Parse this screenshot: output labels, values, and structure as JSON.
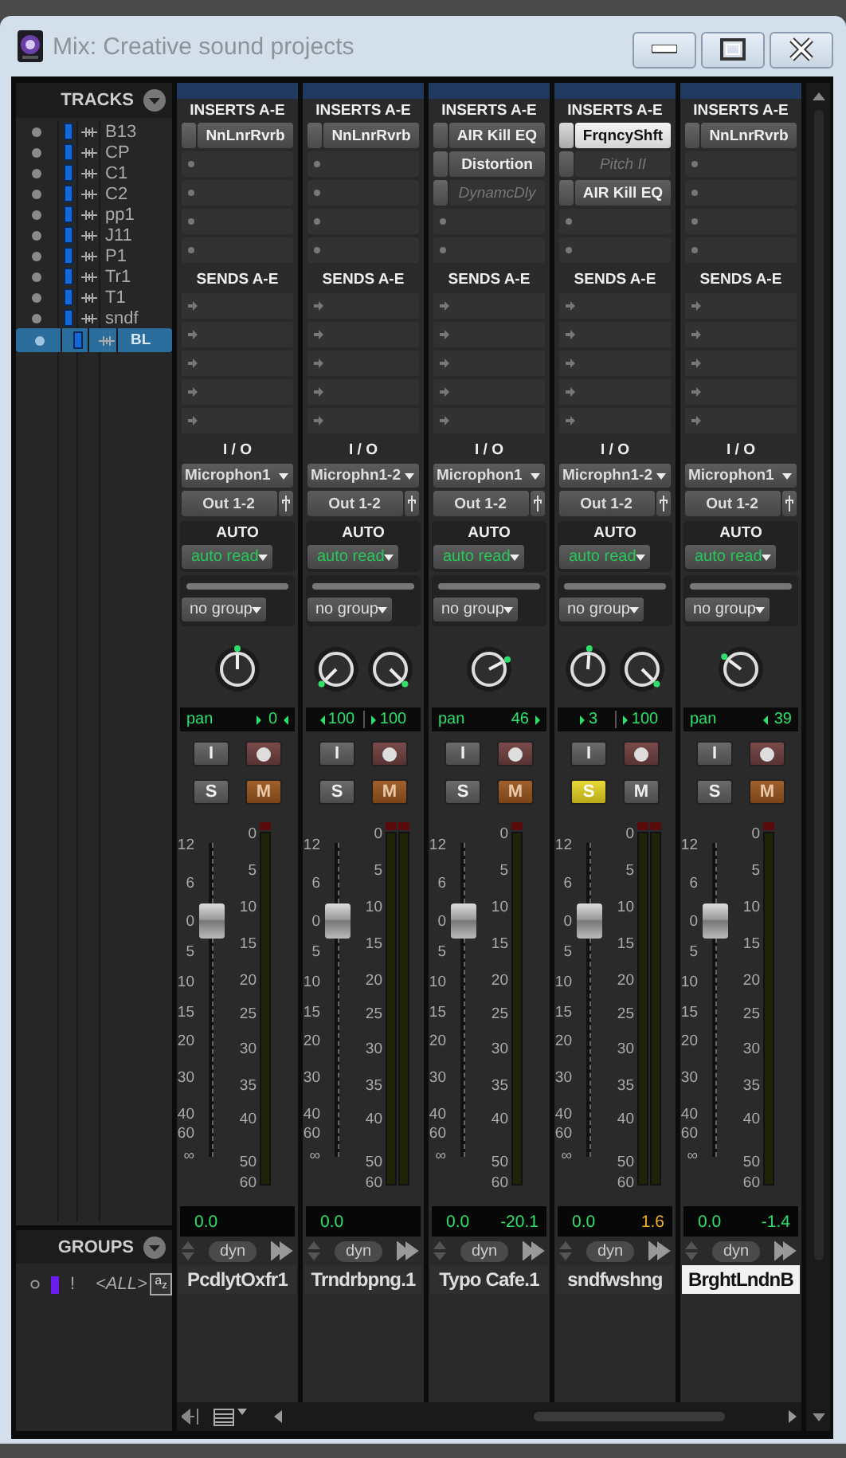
{
  "window": {
    "title": "Mix: Creative sound projects"
  },
  "tracks_panel": {
    "title": "TRACKS",
    "tracks": [
      {
        "name": "B13",
        "selected": false
      },
      {
        "name": "CP",
        "selected": false
      },
      {
        "name": "C1",
        "selected": false
      },
      {
        "name": "C2",
        "selected": false
      },
      {
        "name": "pp1",
        "selected": false
      },
      {
        "name": "J11",
        "selected": false
      },
      {
        "name": "P1",
        "selected": false
      },
      {
        "name": "Tr1",
        "selected": false
      },
      {
        "name": "T1",
        "selected": false
      },
      {
        "name": "sndf",
        "selected": false
      },
      {
        "name": "BL",
        "selected": true
      }
    ]
  },
  "groups_panel": {
    "title": "GROUPS",
    "groups": [
      {
        "flag": "!",
        "name": "<ALL>",
        "color": "#6a1cf0",
        "sort": "a$_{z}$"
      }
    ]
  },
  "strips": [
    {
      "inserts_label": "INSERTS A-E",
      "inserts": [
        {
          "name": "NnLnrRvrb",
          "active": true,
          "selected": false
        }
      ],
      "sends_label": "SENDS A-E",
      "io_label": "I / O",
      "input": "Microphon1",
      "output": "Out 1-2",
      "auto_label": "AUTO",
      "auto": "auto read",
      "group": "no group",
      "pan": {
        "kind": "mono",
        "label": "pan",
        "knobs": [
          {
            "value": "0",
            "left_arrow": true,
            "right_arrow": true
          }
        ]
      },
      "input_button": "I",
      "solo_label": "S",
      "solo": false,
      "mute_label": "M",
      "mute": true,
      "fader": {
        "level": 0.75
      },
      "fader_scale": [
        "12",
        "6",
        "0",
        "5",
        "10",
        "15",
        "20",
        "30",
        "40",
        "60",
        "∞"
      ],
      "meter_scale": [
        "0",
        "5",
        "10",
        "15",
        "20",
        "25",
        "30",
        "35",
        "40",
        "50",
        "60"
      ],
      "volume": "0.0",
      "dyn": "dyn",
      "name": "PcdlytOxfr1",
      "selected": false
    },
    {
      "inserts_label": "INSERTS A-E",
      "inserts": [
        {
          "name": "NnLnrRvrb",
          "active": true,
          "selected": false
        }
      ],
      "sends_label": "SENDS A-E",
      "io_label": "I / O",
      "input": "Microphn1-2",
      "output": "Out 1-2",
      "auto_label": "AUTO",
      "auto": "auto read",
      "group": "no group",
      "pan": {
        "kind": "stereo",
        "knobs": [
          {
            "value": "100",
            "left_arrow": true,
            "right_arrow": false
          },
          {
            "value": "100",
            "left_arrow": false,
            "right_arrow": true
          }
        ]
      },
      "input_button": "I",
      "solo_label": "S",
      "solo": false,
      "mute_label": "M",
      "mute": true,
      "fader": {
        "level": 0.75
      },
      "fader_scale": [
        "12",
        "6",
        "0",
        "5",
        "10",
        "15",
        "20",
        "30",
        "40",
        "60",
        "∞"
      ],
      "meter_scale": [
        "0",
        "5",
        "10",
        "15",
        "20",
        "25",
        "30",
        "35",
        "40",
        "50",
        "60"
      ],
      "volume": "0.0",
      "dyn": "dyn",
      "name": "Trndrbpng.1",
      "selected": false
    },
    {
      "inserts_label": "INSERTS A-E",
      "inserts": [
        {
          "name": "AIR Kill EQ",
          "active": true,
          "selected": false
        },
        {
          "name": "Distortion",
          "active": true,
          "selected": false
        },
        {
          "name": "DynamcDly",
          "active": false,
          "selected": false
        }
      ],
      "sends_label": "SENDS A-E",
      "io_label": "I / O",
      "input": "Microphon1",
      "output": "Out 1-2",
      "auto_label": "AUTO",
      "auto": "auto read",
      "group": "no group",
      "pan": {
        "kind": "mono",
        "label": "pan",
        "knobs": [
          {
            "value": "46",
            "left_arrow": false,
            "right_arrow": true
          }
        ]
      },
      "input_button": "I",
      "solo_label": "S",
      "solo": false,
      "mute_label": "M",
      "mute": true,
      "fader": {
        "level": 0.75
      },
      "fader_scale": [
        "12",
        "6",
        "0",
        "5",
        "10",
        "15",
        "20",
        "30",
        "40",
        "60",
        "∞"
      ],
      "meter_scale": [
        "0",
        "5",
        "10",
        "15",
        "20",
        "25",
        "30",
        "35",
        "40",
        "50",
        "60"
      ],
      "volume": "0.0",
      "peak": {
        "text": "-20.1",
        "over": false
      },
      "dyn": "dyn",
      "name": "Typo Cafe.1",
      "selected": false
    },
    {
      "inserts_label": "INSERTS A-E",
      "inserts": [
        {
          "name": "FrqncyShft",
          "active": true,
          "selected": true
        },
        {
          "name": "Pitch II",
          "active": false,
          "selected": false
        },
        {
          "name": "AIR Kill EQ",
          "active": true,
          "selected": false
        }
      ],
      "sends_label": "SENDS A-E",
      "io_label": "I / O",
      "input": "Microphn1-2",
      "output": "Out 1-2",
      "auto_label": "AUTO",
      "auto": "auto read",
      "group": "no group",
      "pan": {
        "kind": "stereo",
        "knobs": [
          {
            "value": "3",
            "left_arrow": false,
            "right_arrow": true
          },
          {
            "value": "100",
            "left_arrow": false,
            "right_arrow": true
          }
        ]
      },
      "input_button": "I",
      "solo_label": "S",
      "solo": true,
      "mute_label": "M",
      "mute": false,
      "fader": {
        "level": 0.75
      },
      "fader_scale": [
        "12",
        "6",
        "0",
        "5",
        "10",
        "15",
        "20",
        "30",
        "40",
        "60",
        "∞"
      ],
      "meter_scale": [
        "0",
        "5",
        "10",
        "15",
        "20",
        "25",
        "30",
        "35",
        "40",
        "50",
        "60"
      ],
      "volume": "0.0",
      "peak": {
        "text": "1.6",
        "over": true
      },
      "dyn": "dyn",
      "name": "sndfwshng",
      "selected": false
    },
    {
      "inserts_label": "INSERTS A-E",
      "inserts": [
        {
          "name": "NnLnrRvrb",
          "active": true,
          "selected": false
        }
      ],
      "sends_label": "SENDS A-E",
      "io_label": "I / O",
      "input": "Microphon1",
      "output": "Out 1-2",
      "auto_label": "AUTO",
      "auto": "auto read",
      "group": "no group",
      "pan": {
        "kind": "mono",
        "label": "pan",
        "knobs": [
          {
            "value": "39",
            "left_arrow": true,
            "right_arrow": false
          }
        ]
      },
      "input_button": "I",
      "solo_label": "S",
      "solo": false,
      "mute_label": "M",
      "mute": true,
      "fader": {
        "level": 0.75
      },
      "fader_scale": [
        "12",
        "6",
        "0",
        "5",
        "10",
        "15",
        "20",
        "30",
        "40",
        "60",
        "∞"
      ],
      "meter_scale": [
        "0",
        "5",
        "10",
        "15",
        "20",
        "25",
        "30",
        "35",
        "40",
        "50",
        "60"
      ],
      "volume": "0.0",
      "peak": {
        "text": "-1.4",
        "over": false
      },
      "dyn": "dyn",
      "name": "BrghtLndnB",
      "selected": true
    }
  ]
}
